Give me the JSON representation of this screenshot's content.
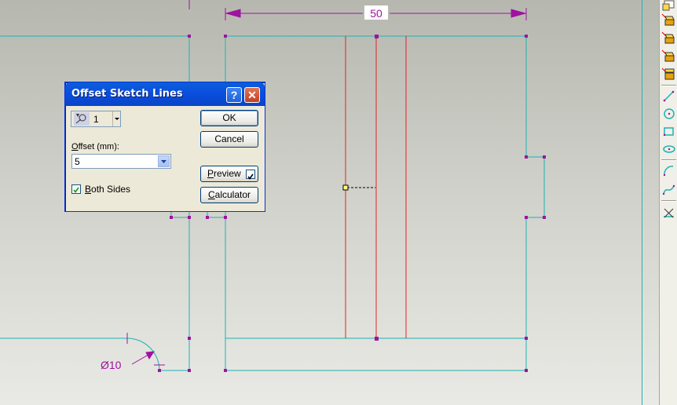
{
  "sketch": {
    "dimension_width": "50",
    "dimension_diameter": "Ø10"
  },
  "dialog": {
    "title": "Offset Sketch Lines",
    "help_glyph": "?",
    "close_glyph": "✕",
    "count_value": "1",
    "offset_label": "Offset (mm):",
    "offset_value": "5",
    "both_sides_label": "Both Sides",
    "both_sides_checked": true,
    "ok_label": "OK",
    "cancel_label": "Cancel",
    "preview_label": "Preview",
    "preview_checked": true,
    "calculator_label": "Calculator",
    "icons": {
      "count": "offset-pick-icon",
      "dropdown": "chevron-down-icon"
    }
  },
  "toolbar": {
    "icons": [
      "part-icon",
      "feature-icon",
      "feature-icon",
      "feature-icon",
      "feature-icon",
      "line-icon",
      "circle-icon",
      "rectangle-icon",
      "ellipse-icon",
      "arc-icon",
      "spline-icon",
      "trim-icon"
    ]
  },
  "colors": {
    "sketch_line": "#1fb2b2",
    "offset_line": "#e0222a",
    "dimension": "#a012a0",
    "dialog_title": "#0b4ee0"
  }
}
